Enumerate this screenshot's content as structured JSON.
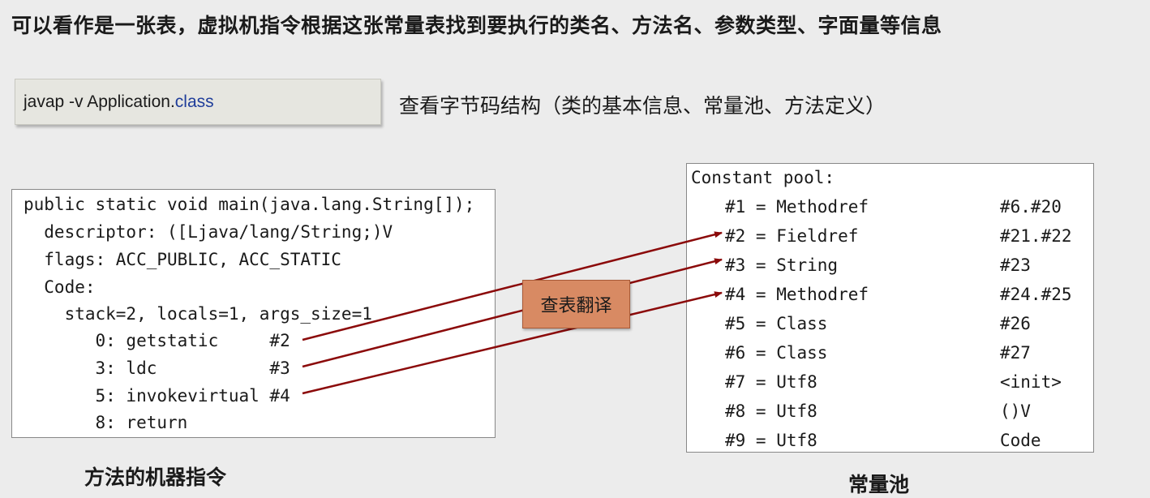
{
  "headline": "可以看作是一张表，虚拟机指令根据这张常量表找到要执行的类名、方法名、参数类型、字面量等信息",
  "command": {
    "prefix": "javap -v Application.",
    "ext": "class",
    "description": "查看字节码结构（类的基本信息、常量池、方法定义）"
  },
  "code": {
    "lines": [
      "public static void main(java.lang.String[]);",
      "  descriptor: ([Ljava/lang/String;)V",
      "  flags: ACC_PUBLIC, ACC_STATIC",
      "  Code:",
      "    stack=2, locals=1, args_size=1",
      "       0: getstatic     #2",
      "       3: ldc           #3",
      "       5: invokevirtual #4",
      "       8: return"
    ],
    "caption": "方法的机器指令"
  },
  "pool": {
    "header": "Constant pool:",
    "entries": [
      {
        "ref": "#1 = Methodref",
        "value": "#6.#20"
      },
      {
        "ref": "#2 = Fieldref",
        "value": "#21.#22"
      },
      {
        "ref": "#3 = String",
        "value": "#23"
      },
      {
        "ref": "#4 = Methodref",
        "value": "#24.#25"
      },
      {
        "ref": "#5 = Class",
        "value": "#26"
      },
      {
        "ref": "#6 = Class",
        "value": "#27"
      },
      {
        "ref": "#7 = Utf8",
        "value": "<init>"
      },
      {
        "ref": "#8 = Utf8",
        "value": "()V"
      },
      {
        "ref": "#9 = Utf8",
        "value": "Code"
      }
    ],
    "caption": "常量池"
  },
  "badge": "查表翻译",
  "colors": {
    "arrow": "#8b0a0a",
    "badge": "#d88a63",
    "keyword": "#1f3d9a"
  }
}
